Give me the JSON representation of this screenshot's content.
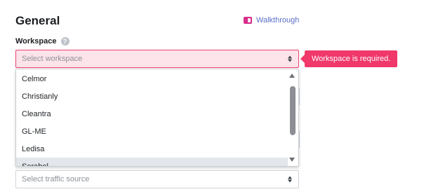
{
  "section": {
    "title": "General",
    "walkthrough_label": "Walkthrough"
  },
  "workspace": {
    "label": "Workspace",
    "help_glyph": "?",
    "placeholder": "Select workspace",
    "error": "Workspace is required.",
    "options": [
      "Celmor",
      "Christianly",
      "Cleantra",
      "GL-ME",
      "Ledisa",
      "Serabel"
    ],
    "highlighted_option": "Serabel"
  },
  "traffic_source": {
    "placeholder": "Select traffic source"
  },
  "colors": {
    "error": "#f0386b",
    "accent": "#5a6fc9",
    "brand_icon": "#d92c8a"
  },
  "icons": {
    "walkthrough": "book-icon",
    "help": "question-circle-icon",
    "select": "updown-arrows-icon"
  }
}
